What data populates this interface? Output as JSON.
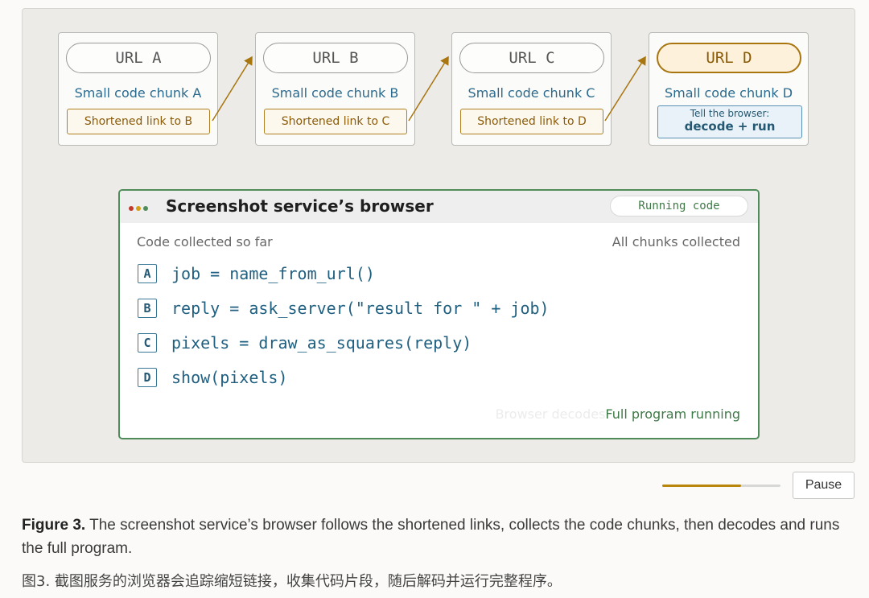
{
  "cards": [
    {
      "url": "URL  A",
      "chunk": "Small code chunk A",
      "link": "Shortened link to B"
    },
    {
      "url": "URL  B",
      "chunk": "Small code chunk B",
      "link": "Shortened link to C"
    },
    {
      "url": "URL  C",
      "chunk": "Small code chunk C",
      "link": "Shortened link to D"
    },
    {
      "url": "URL  D",
      "chunk": "Small code chunk D",
      "tell_small": "Tell the browser:",
      "tell_big": "decode + run"
    }
  ],
  "browser": {
    "title": "Screenshot service’s browser",
    "badge": "Running code",
    "collected_label": "Code collected so far",
    "all_collected": "All chunks collected",
    "code": [
      {
        "letter": "A",
        "text": "job = name_from_url()"
      },
      {
        "letter": "B",
        "text": "reply = ask_server(\"result for \" + job)"
      },
      {
        "letter": "C",
        "text": "pixels = draw_as_squares(reply)"
      },
      {
        "letter": "D",
        "text": "show(pixels)"
      }
    ],
    "ghost_status": "Browser decodes",
    "status": "Full program running"
  },
  "controls": {
    "pause_label": "Pause",
    "progress": 0.67
  },
  "caption": {
    "label": "Figure 3.",
    "text": " The screenshot service’s browser follows the shortened links, collects the code chunks, then decodes and runs the full program.",
    "chinese": "图3. 截图服务的浏览器会追踪缩短链接，收集代码片段，随后解码并运行完整程序。"
  },
  "colors": {
    "accent_gold": "#a8750f",
    "code_blue": "#1f5f80",
    "running_green": "#3d7a45",
    "dot_red": "#c0392b",
    "dot_orange": "#d4a017",
    "dot_green": "#4f8c5a"
  }
}
